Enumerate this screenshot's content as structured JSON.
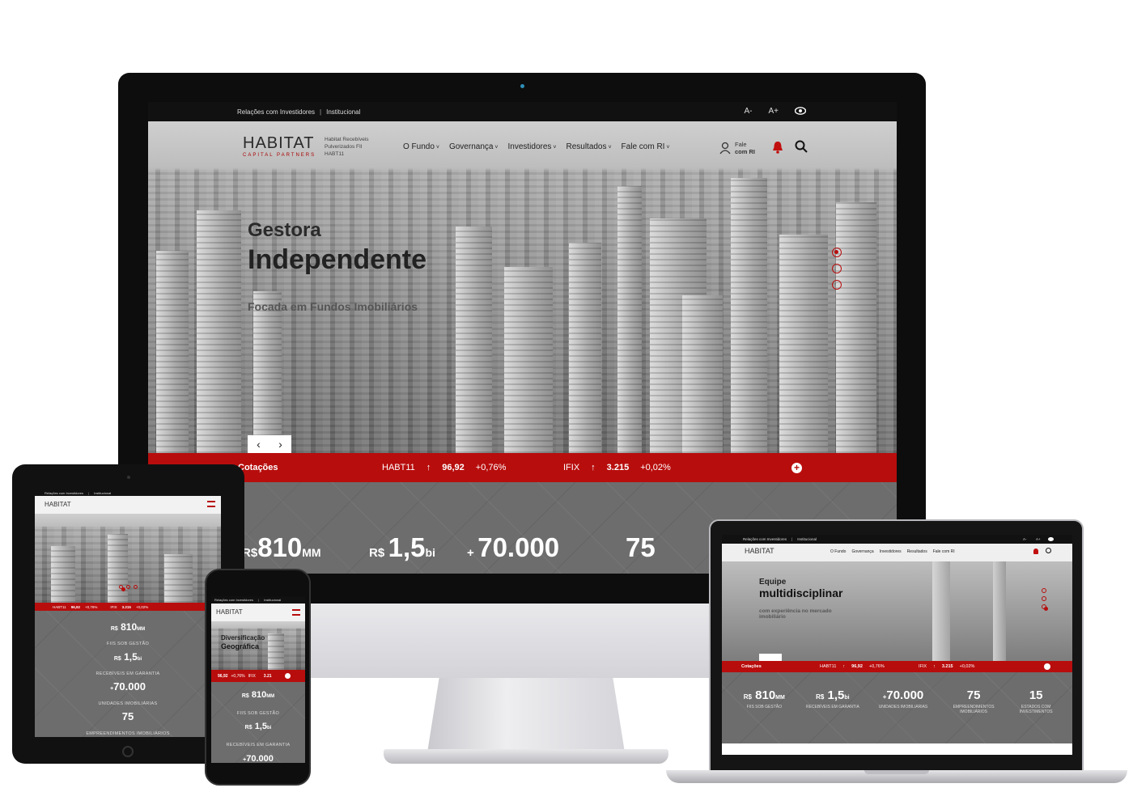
{
  "monitor": {
    "top_links": [
      "Relações com Investidores",
      "Institucional"
    ],
    "font_controls": [
      "A-",
      "A+"
    ],
    "logo_main": "HABITAT",
    "logo_sub": "CAPITAL PARTNERS",
    "fund_name": "Habitat Recebíveis Pulverizados FII HABT11",
    "nav": [
      "O Fundo",
      "Governança",
      "Investidores",
      "Resultados",
      "Fale com RI"
    ],
    "fale_line1": "Fale",
    "fale_line2": "com RI",
    "hero_title_1": "Gestora",
    "hero_title_2": "Independente",
    "hero_subtitle": "Focada em Fundos Imobiliários",
    "arrow_prev": "‹",
    "arrow_next": "›",
    "ticker": {
      "label": "Cotações",
      "items": [
        {
          "symbol": "HABT11",
          "arrow": "↑",
          "price": "96,92",
          "change": "+0,76%"
        },
        {
          "symbol": "IFIX",
          "arrow": "↑",
          "price": "3.215",
          "change": "+0,02%"
        }
      ],
      "plus": "+"
    },
    "stats": [
      {
        "prefix": "R$",
        "value": "810",
        "suffix": "MM"
      },
      {
        "prefix": "R$",
        "value": "1,5",
        "suffix": "bi"
      },
      {
        "prefix": "+",
        "value": "70.000",
        "suffix": ""
      },
      {
        "prefix": "",
        "value": "75",
        "suffix": ""
      }
    ],
    "colors": {
      "accent": "#b80d0d",
      "dark": "#111111",
      "stats_bg": "#6d6d6d"
    }
  },
  "tablet": {
    "top_links": [
      "Relações com Investidores",
      "Institucional"
    ],
    "logo_main": "HABITAT",
    "ticker": {
      "items": [
        {
          "symbol": "HABT11",
          "price": "96,92",
          "change": "+0,76%"
        },
        {
          "symbol": "IFIX",
          "price": "3.215",
          "change": "+0,02%"
        }
      ]
    },
    "stats": [
      {
        "prefix": "R$",
        "value": "810",
        "suffix": "MM",
        "caption": "FIIS SOB GESTÃO"
      },
      {
        "prefix": "R$",
        "value": "1,5",
        "suffix": "bi",
        "caption": "RECEBÍVEIS EM GARANTIA"
      },
      {
        "prefix": "+",
        "value": "70.000",
        "suffix": "",
        "caption": "UNIDADES IMOBILIÁRIAS"
      },
      {
        "prefix": "",
        "value": "75",
        "suffix": "",
        "caption": "EMPREENDIMENTOS IMOBILIÁRIOS"
      }
    ]
  },
  "phone": {
    "top_links": [
      "Relações com Investidores",
      "Institucional"
    ],
    "logo_main": "HABITAT",
    "hero_title_1": "Diversificação",
    "hero_title_2": "Geográfica",
    "ticker": {
      "price1": "96,92",
      "change1": "+0,76%",
      "symbol2": "IFIX",
      "price2": "3.21"
    },
    "stats": [
      {
        "prefix": "R$",
        "value": "810",
        "suffix": "MM",
        "caption": "FIIS SOB GESTÃO"
      },
      {
        "prefix": "R$",
        "value": "1,5",
        "suffix": "bi",
        "caption": "RECEBÍVEIS EM GARANTIA"
      },
      {
        "prefix": "+",
        "value": "70.000",
        "suffix": ""
      }
    ]
  },
  "laptop": {
    "top_links": [
      "Relações com Investidores",
      "Institucional"
    ],
    "font_controls": [
      "A-",
      "A+"
    ],
    "logo_main": "HABITAT",
    "nav": [
      "O Fundo",
      "Governança",
      "Investidores",
      "Resultados",
      "Fale com RI"
    ],
    "hero_title_1": "Equipe",
    "hero_title_2": "multidisciplinar",
    "hero_subtitle": "com experiência no mercado imobiliário",
    "ticker": {
      "label": "Cotações",
      "items": [
        {
          "symbol": "HABT11",
          "arrow": "↑",
          "price": "96,92",
          "change": "+0,76%"
        },
        {
          "symbol": "IFIX",
          "arrow": "↑",
          "price": "3.215",
          "change": "+0,02%"
        }
      ]
    },
    "stats": [
      {
        "prefix": "R$",
        "value": "810",
        "suffix": "MM",
        "caption": "FIIS SOB GESTÃO"
      },
      {
        "prefix": "R$",
        "value": "1,5",
        "suffix": "bi",
        "caption": "RECEBÍVEIS EM GARANTIA"
      },
      {
        "prefix": "+",
        "value": "70.000",
        "suffix": "",
        "caption": "UNIDADES IMOBILIÁRIAS"
      },
      {
        "prefix": "",
        "value": "75",
        "suffix": "",
        "caption": "EMPREENDIMENTOS IMOBILIÁRIOS"
      },
      {
        "prefix": "",
        "value": "15",
        "suffix": "",
        "caption": "ESTADOS COM INVESTIMENTOS"
      }
    ]
  }
}
